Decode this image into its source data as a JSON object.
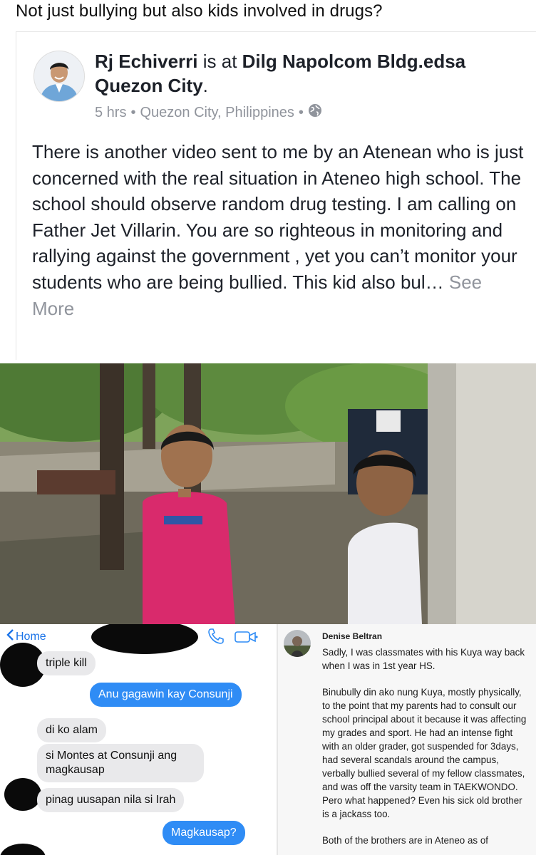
{
  "caption": "Not just bullying but also kids involved in drugs?",
  "post": {
    "author": "Rj Echiverri",
    "connector": " is at ",
    "location_place": "Dilg Napolcom Bldg.edsa Quezon City",
    "period": ".",
    "time": "5 hrs",
    "sep1": "•",
    "city": "Quezon City, Philippines",
    "sep2": "•",
    "privacy_icon": "globe-icon",
    "body": "There is another video sent to me by an Atenean who is just concerned with the real situation in Ateneo high school. The school should observe random drug testing. I am calling on Father Jet Villarin. You are so righteous in monitoring and rallying against the government , yet you can’t monitor your students who are being bullied. This kid also bul…",
    "see_more": " See More"
  },
  "chat": {
    "back_label": "Home",
    "phone_icon": "phone-icon",
    "video_icon": "video-camera-icon",
    "messages": [
      {
        "from": "them",
        "text": "triple kill"
      },
      {
        "from": "me",
        "text": "Anu gagawin kay Consunji"
      },
      {
        "from": "them",
        "text": "di ko alam"
      },
      {
        "from": "them",
        "text": "si Montes at Consunji ang magkausap"
      },
      {
        "from": "them",
        "text": "pinag uusapan nila si Irah"
      },
      {
        "from": "me",
        "text": "Magkausap?"
      }
    ],
    "colors": {
      "sent": "#2f8cf5",
      "received": "#e9e9eb",
      "link": "#1a73e8"
    }
  },
  "comment": {
    "name": "Denise Beltran",
    "paragraphs": [
      "Sadly, I was classmates with his Kuya way back when I was in 1st year HS.",
      "Binubully din ako nung Kuya, mostly physically, to the point that my parents had to consult our school principal about it because it was affecting my grades and sport. He had an intense fight with an older grader, got suspended for 3days, had several scandals around the campus, verbally bullied several of my fellow classmates, and was off the varsity team in TAEKWONDO. Pero what happened? Even his sick old brother is a jackass too.",
      "Both of the brothers are in Ateneo as of"
    ]
  }
}
